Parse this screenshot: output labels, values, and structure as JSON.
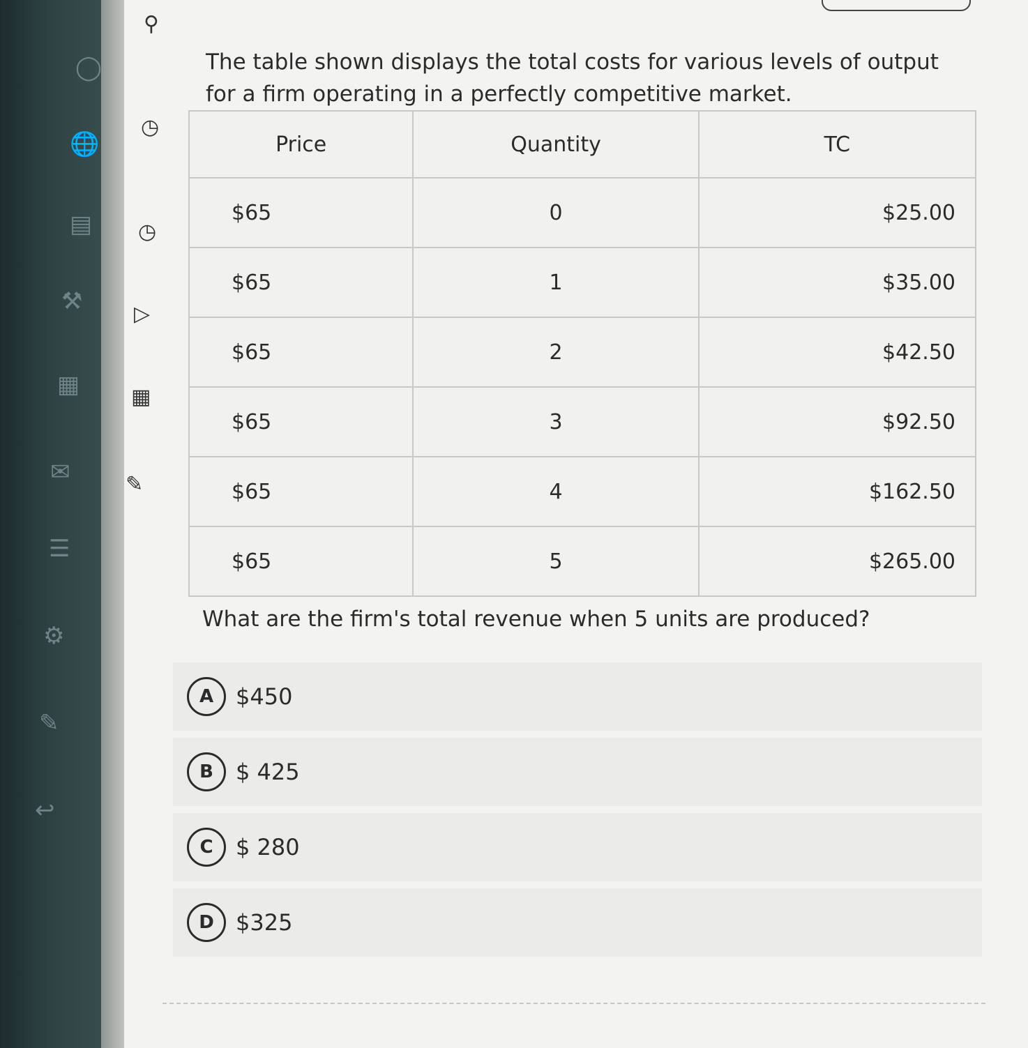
{
  "question": {
    "text": "The table shown displays the total costs for various levels of output for a firm operating in a perfectly competitive market.",
    "prompt": "What are the firm's total revenue when 5 units are produced?"
  },
  "table": {
    "headers": [
      "Price",
      "Quantity",
      "TC"
    ],
    "rows": [
      [
        "$65",
        "0",
        "$25.00"
      ],
      [
        "$65",
        "1",
        "$35.00"
      ],
      [
        "$65",
        "2",
        "$42.50"
      ],
      [
        "$65",
        "3",
        "$92.50"
      ],
      [
        "$65",
        "4",
        "$162.50"
      ],
      [
        "$65",
        "5",
        "$265.00"
      ]
    ]
  },
  "options": [
    {
      "letter": "A",
      "value": "$450"
    },
    {
      "letter": "B",
      "value": "$ 425"
    },
    {
      "letter": "C",
      "value": "$ 280"
    },
    {
      "letter": "D",
      "value": "$325"
    }
  ],
  "icons": {
    "rail": [
      "user-icon",
      "globe-icon",
      "document-icon",
      "tools-icon",
      "calculator-icon",
      "mail-icon",
      "notes-icon",
      "settings-icon",
      "edit-icon",
      "back-icon"
    ],
    "gutter": [
      "person-icon",
      "info-icon",
      "check-icon",
      "expand-icon",
      "grid-icon",
      "pencil-icon"
    ]
  }
}
